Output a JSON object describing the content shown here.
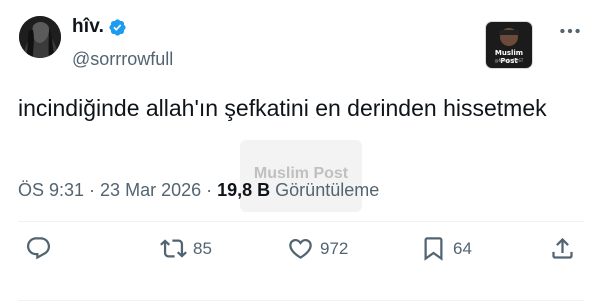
{
  "author": {
    "display_name": "hîv.",
    "handle": "@sorrrowfull",
    "verified": true
  },
  "external_logo": {
    "name": "Muslim Post",
    "sub": "@MuslimPOST"
  },
  "tweet": {
    "text": "incindiğinde allah'ın şefkatini en derinden hissetmek"
  },
  "watermark": {
    "text": "Muslim Post"
  },
  "meta": {
    "time": "ÖS 9:31",
    "separator1": " · ",
    "date": "23 Mar 2026",
    "separator2": " · ",
    "views_count": "19,8 B",
    "views_label": " Görüntüleme"
  },
  "actions": {
    "reply_count": "",
    "retweet_count": "85",
    "like_count": "972",
    "bookmark_count": "64"
  },
  "colors": {
    "verified": "#1d9bf0",
    "muted": "#536471",
    "text": "#0f1419"
  }
}
